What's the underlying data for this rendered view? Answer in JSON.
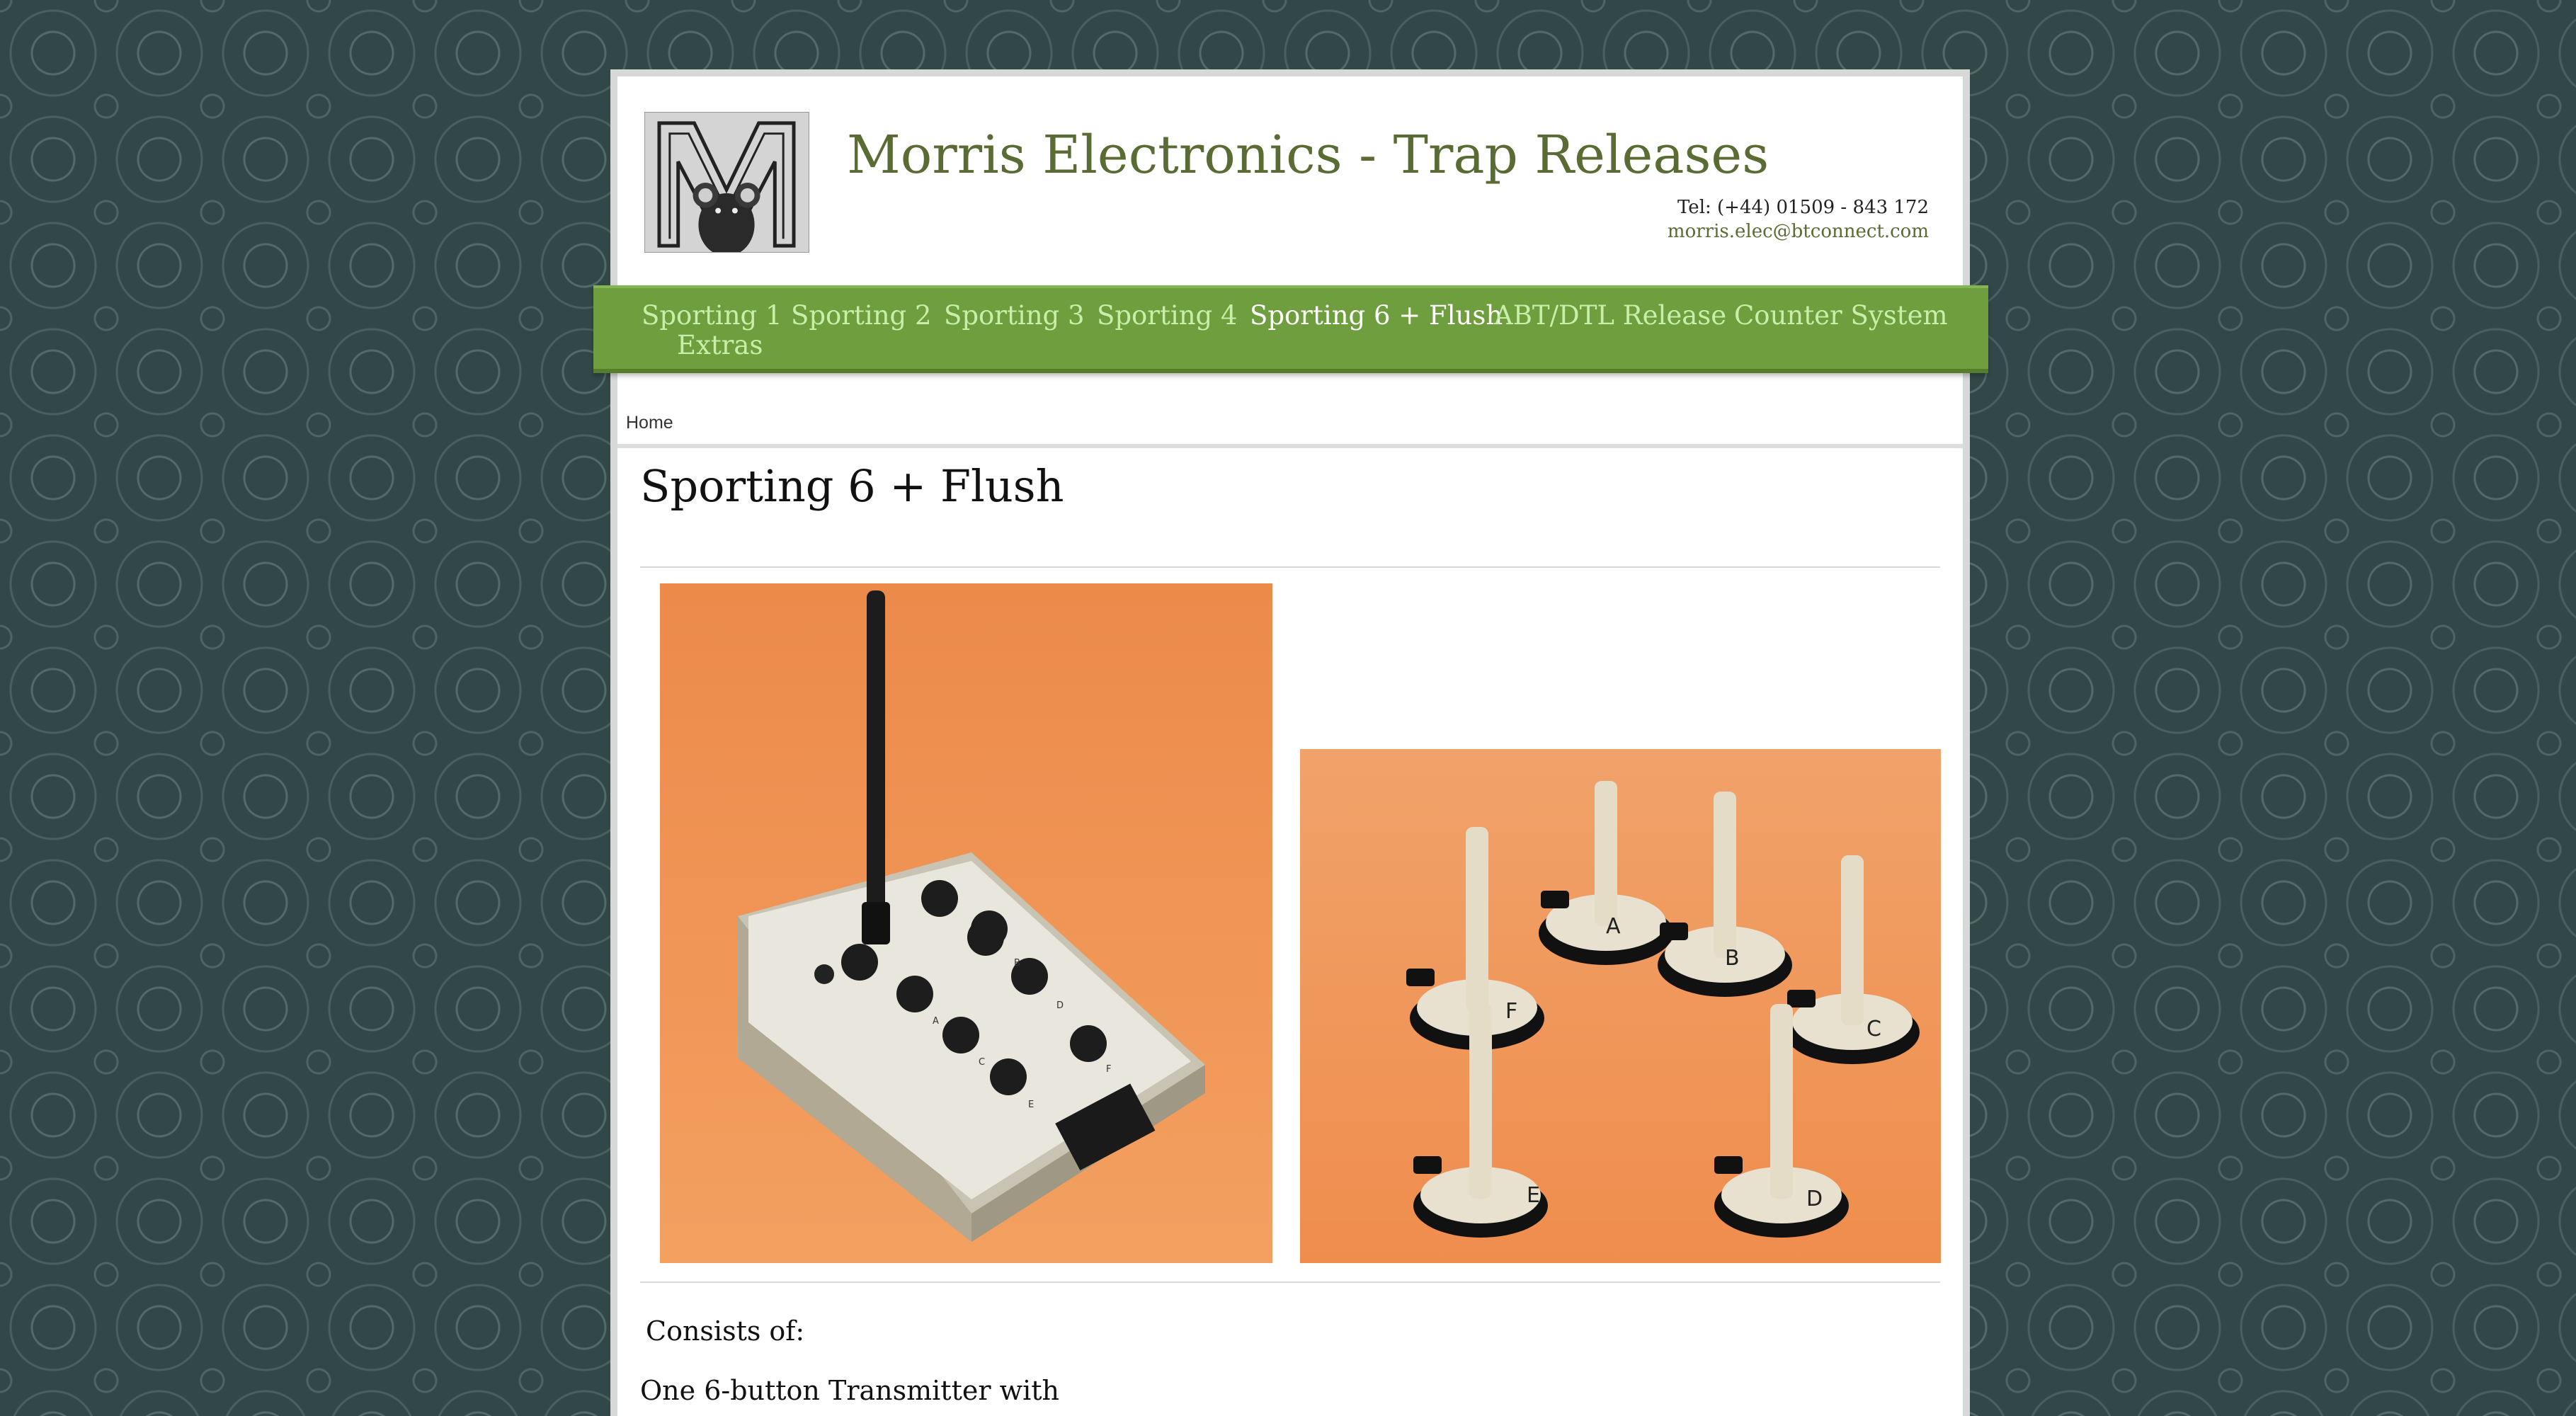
{
  "site": {
    "title": "Morris Electronics - Trap Releases",
    "tel": "Tel: (+44) 01509 - 843 172",
    "email": "morris.elec@btconnect.com"
  },
  "nav": {
    "items": [
      {
        "label": "Sporting 1",
        "active": false
      },
      {
        "label": "Sporting 2",
        "active": false
      },
      {
        "label": "Sporting 3",
        "active": false
      },
      {
        "label": "Sporting 4",
        "active": false
      },
      {
        "label": "Sporting 6 + Flush",
        "active": true
      },
      {
        "label": "ABT/DTL Release",
        "active": false
      },
      {
        "label": "Counter System",
        "active": false
      },
      {
        "label": "Extras",
        "active": false
      }
    ]
  },
  "breadcrumb": {
    "home": "Home"
  },
  "page": {
    "title": "Sporting 6 + Flush",
    "consists": "Consists of:",
    "line1": "One 6-button Transmitter with"
  },
  "images": {
    "transmitter": {
      "labels": [
        "A",
        "B",
        "C",
        "D",
        "E",
        "F"
      ]
    },
    "receivers": {
      "labels": [
        "A",
        "B",
        "C",
        "D",
        "E",
        "F"
      ]
    }
  },
  "colors": {
    "background": "#324848",
    "title": "#5a6b34",
    "nav": "#6f9e3e",
    "nav_text": "#c9eeaa",
    "nav_active": "#ffffff",
    "photo_bg": "#f08a48"
  }
}
